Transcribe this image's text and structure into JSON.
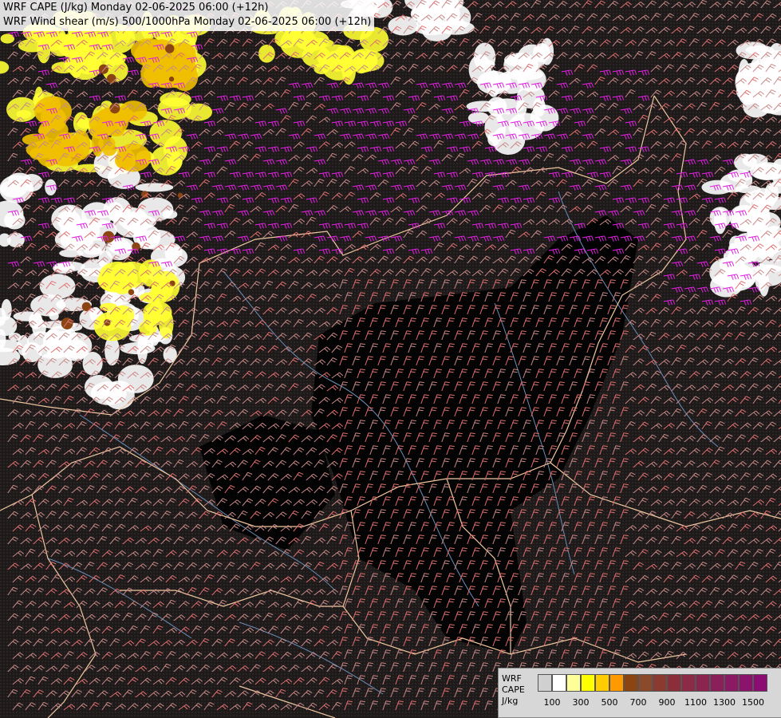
{
  "header": {
    "line1": "WRF CAPE (J/kg) Monday 02-06-2025 06:00 (+12h)",
    "line2": "WRF Wind shear (m/s) 500/1000hPa Monday 02-06-2025 06:00 (+12h)"
  },
  "legend": {
    "model": "WRF",
    "variable": "CAPE",
    "unit": "J/kg",
    "tick_labels": [
      "100",
      "300",
      "500",
      "700",
      "900",
      "1100",
      "1300",
      "1500"
    ],
    "colors": [
      "#d0d0d0",
      "#ffffff",
      "#ffff99",
      "#ffff00",
      "#ffcc00",
      "#ff9900",
      "#8b4513",
      "#8b4a2b",
      "#8a3a2e",
      "#8b2e3a",
      "#8b2b45",
      "#8b2550",
      "#8b1f5a",
      "#8b1963",
      "#8b136b",
      "#8b0d73"
    ]
  },
  "map": {
    "background": "#000000",
    "border_color": "#f0c8a0",
    "river_color": "#6a8fb8",
    "barb_colors": {
      "weak": "#c78a88",
      "medium": "#e07070",
      "strong": "#e020e0"
    },
    "cape_colors": {
      "low": "#ffffff",
      "mid": "#ffff33",
      "high": "#f0c000",
      "peak": "#8b4513"
    }
  }
}
